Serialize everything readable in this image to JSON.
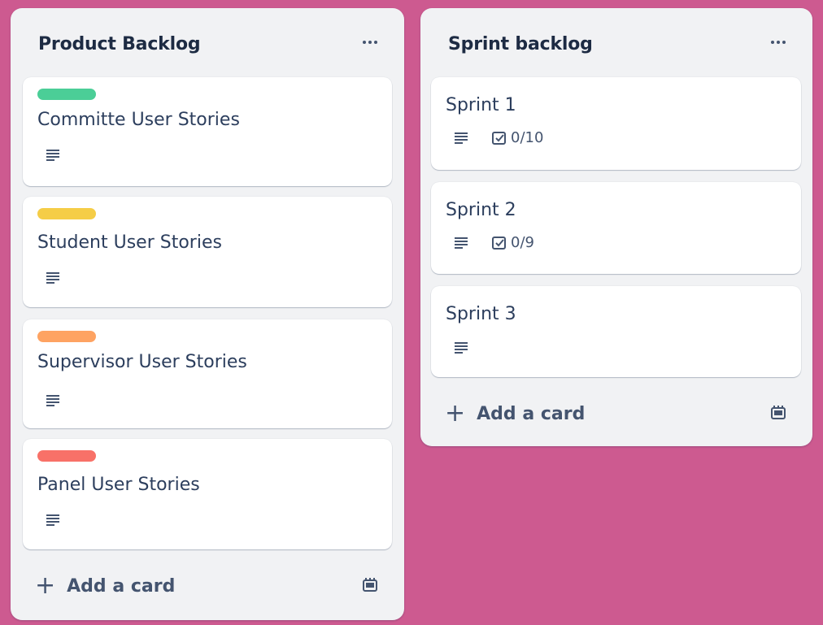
{
  "lists": [
    {
      "title": "Product Backlog",
      "add_label": "Add a card",
      "cards": [
        {
          "title": "Committe User Stories",
          "label_color": "#4bce97"
        },
        {
          "title": "Student User Stories",
          "label_color": "#f5cd47"
        },
        {
          "title": "Supervisor User Stories",
          "label_color": "#fea362"
        },
        {
          "title": "Panel User Stories",
          "label_color": "#f87168"
        }
      ]
    },
    {
      "title": "Sprint backlog",
      "add_label": "Add a card",
      "cards": [
        {
          "title": "Sprint 1",
          "checklist": "0/10"
        },
        {
          "title": "Sprint 2",
          "checklist": "0/9"
        },
        {
          "title": "Sprint 3"
        }
      ]
    }
  ],
  "icons": {
    "menu": "more-horizontal-icon",
    "description": "description-lines-icon",
    "checklist": "checklist-icon",
    "add": "plus-icon",
    "template": "card-template-icon"
  }
}
